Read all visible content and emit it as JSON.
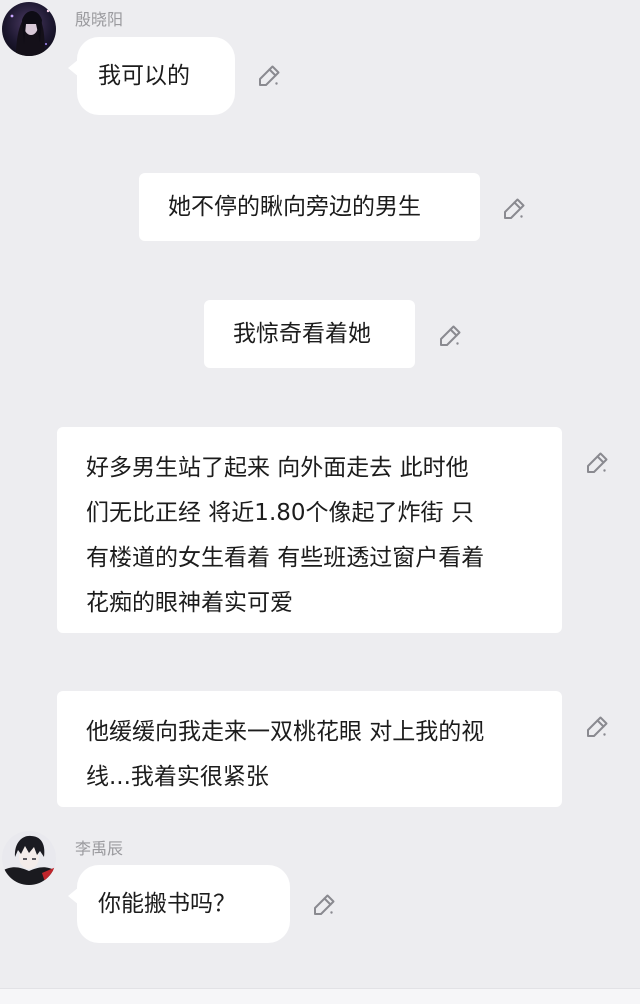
{
  "messages": [
    {
      "type": "chat",
      "sender": "殷晓阳",
      "text": "我可以的"
    },
    {
      "type": "narration",
      "text": "她不停的瞅向旁边的男生"
    },
    {
      "type": "narration",
      "text": "我惊奇看着她"
    },
    {
      "type": "narration",
      "lines": [
        "好多男生站了起来 向外面走去 此时他",
        "们无比正经 将近1.80个像起了炸街  只",
        "有楼道的女生看着 有些班透过窗户看着",
        "花痴的眼神着实可爱"
      ]
    },
    {
      "type": "narration",
      "lines": [
        "他缓缓向我走来一双桃花眼 对上我的视",
        "线...我着实很紧张"
      ]
    },
    {
      "type": "chat",
      "sender": "李禹辰",
      "text": "你能搬书吗？"
    }
  ],
  "icons": {
    "edit": "edit-pen-icon",
    "avatar": "avatar-image"
  },
  "colors": {
    "background": "#ededf0",
    "bubble": "#ffffff",
    "name": "#9a9a9e",
    "icon": "#8a8a90"
  }
}
